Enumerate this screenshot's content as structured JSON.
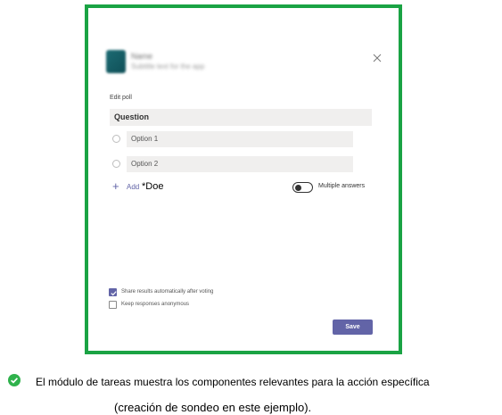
{
  "dialog": {
    "app_name": "Name",
    "app_subtitle": "Subtitle text for the app",
    "close_icon": "close-icon",
    "section_title": "Edit poll",
    "question_placeholder": "Question",
    "options": [
      {
        "placeholder": "Option 1"
      },
      {
        "placeholder": "Option 2"
      }
    ],
    "add_label": "Add",
    "add_extra_text": "*Doe",
    "multiple_answers_label": "Multiple answers",
    "multiple_answers_on": false,
    "share_results_label": "Share results automatically after voting",
    "share_results_checked": true,
    "keep_anonymous_label": "Keep responses anonymous",
    "keep_anonymous_checked": false,
    "save_label": "Save"
  },
  "caption": {
    "icon": "check-circle-icon",
    "line1": "El módulo de tareas muestra los componentes relevantes para la acción específica",
    "line2": "(creación de sondeo en este ejemplo)."
  },
  "colors": {
    "frame_border": "#1aa344",
    "accent": "#6264a7",
    "success": "#2fb24c"
  }
}
